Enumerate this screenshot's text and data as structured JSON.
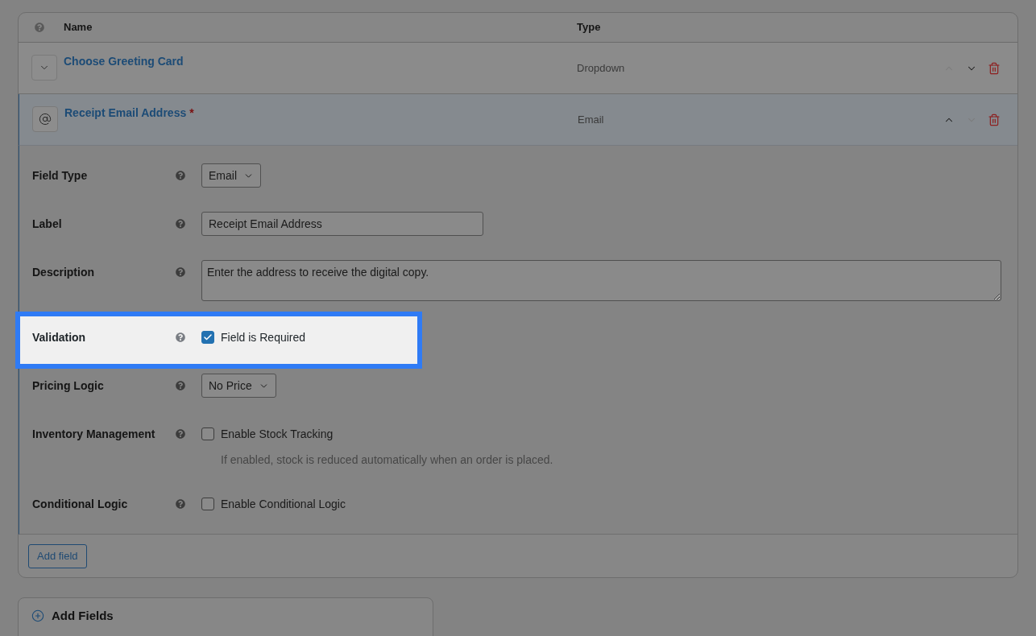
{
  "table": {
    "columns": [
      "Name",
      "Type"
    ],
    "rows": [
      {
        "kind": "dropdown",
        "name": "Choose Greeting Card",
        "type": "Dropdown",
        "expanded": false,
        "move_up_disabled": true,
        "move_down_disabled": false
      },
      {
        "kind": "email",
        "name": "Receipt Email Address",
        "required_mark": "*",
        "type": "Email",
        "expanded": true,
        "move_up_disabled": false,
        "move_down_disabled": true,
        "settings": [
          {
            "kind": "select",
            "label": "Field Type",
            "value": "Email",
            "highlighted": false
          },
          {
            "kind": "text",
            "label": "Label",
            "value": "Receipt Email Address",
            "highlighted": false
          },
          {
            "kind": "textarea",
            "label": "Description",
            "value": "Enter the address to receive the digital copy.",
            "highlighted": false
          },
          {
            "kind": "checkbox",
            "label": "Validation",
            "option": "Field is Required",
            "checked": true,
            "highlighted": true
          },
          {
            "kind": "select",
            "label": "Pricing Logic",
            "value": "No Price",
            "highlighted": false
          },
          {
            "kind": "checkbox",
            "label": "Inventory Management",
            "option": "Enable Stock Tracking",
            "checked": false,
            "note": "If enabled, stock is reduced automatically when an order is placed.",
            "highlighted": false
          },
          {
            "kind": "checkbox",
            "label": "Conditional Logic",
            "option": "Enable Conditional Logic",
            "checked": false,
            "highlighted": false
          }
        ]
      }
    ]
  },
  "add_field_button": "Add field",
  "add_fields_panel": {
    "title": "Add Fields"
  }
}
